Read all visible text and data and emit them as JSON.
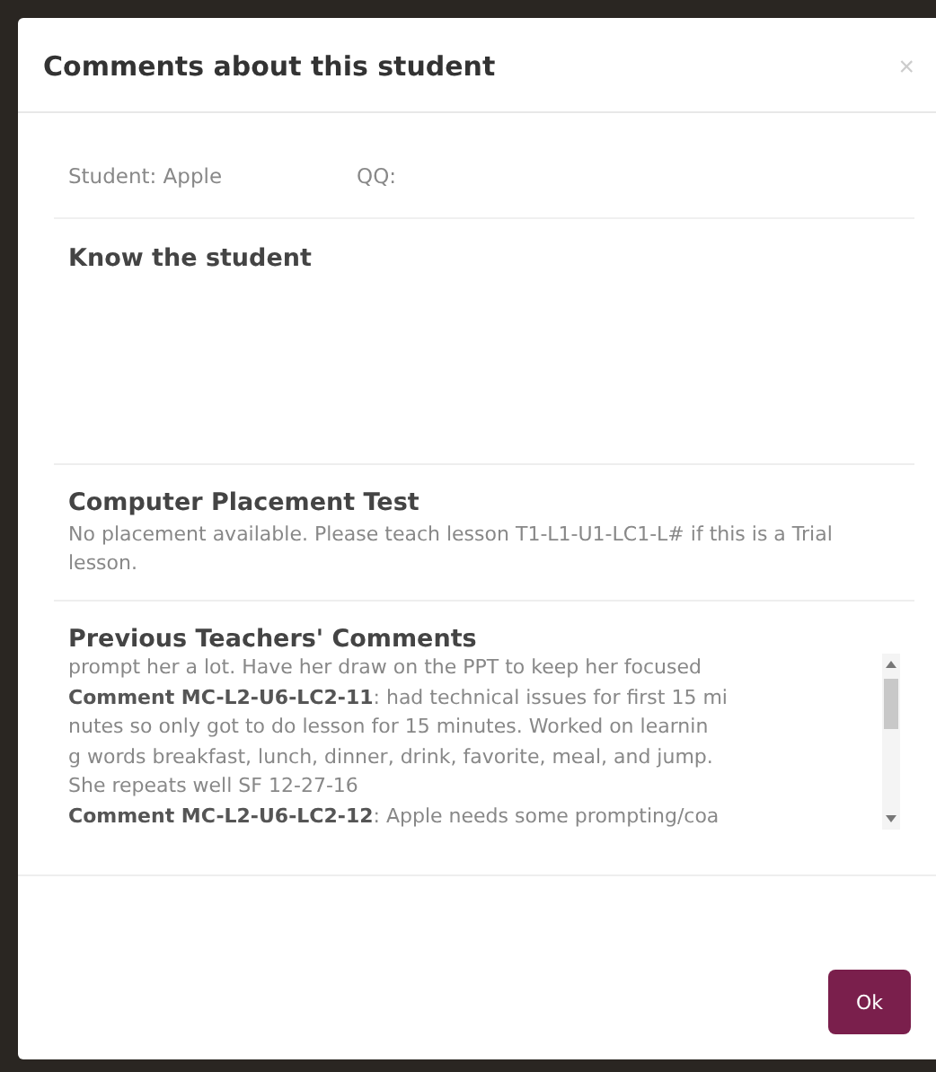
{
  "dialog": {
    "title": "Comments about this student",
    "close": "×"
  },
  "student": {
    "name": "Student: Apple",
    "qq": "QQ:"
  },
  "know_the_student": {
    "heading": "Know the student"
  },
  "placement": {
    "heading": "Computer Placement Test",
    "text": "No placement available. Please teach lesson T1-L1-U1-LC1-L# if this is a Trial lesson."
  },
  "previous_comments": {
    "heading": "Previous Teachers' Comments",
    "lines": [
      {
        "text": "prompt her a lot. Have her draw on the PPT to keep her focused"
      },
      {
        "label": "Comment MC-L2-U6-LC2-11",
        "text": ": had technical issues for first 15 mi"
      },
      {
        "text": "nutes so only got to do lesson for 15 minutes. Worked on learnin"
      },
      {
        "text": "g words breakfast, lunch, dinner, drink, favorite, meal, and jump."
      },
      {
        "text": "She repeats well SF 12-27-16"
      },
      {
        "label": "Comment MC-L2-U6-LC2-12",
        "text": ": Apple needs some prompting/coa"
      }
    ]
  },
  "buttons": [
    {
      "label": "Ok"
    }
  ]
}
